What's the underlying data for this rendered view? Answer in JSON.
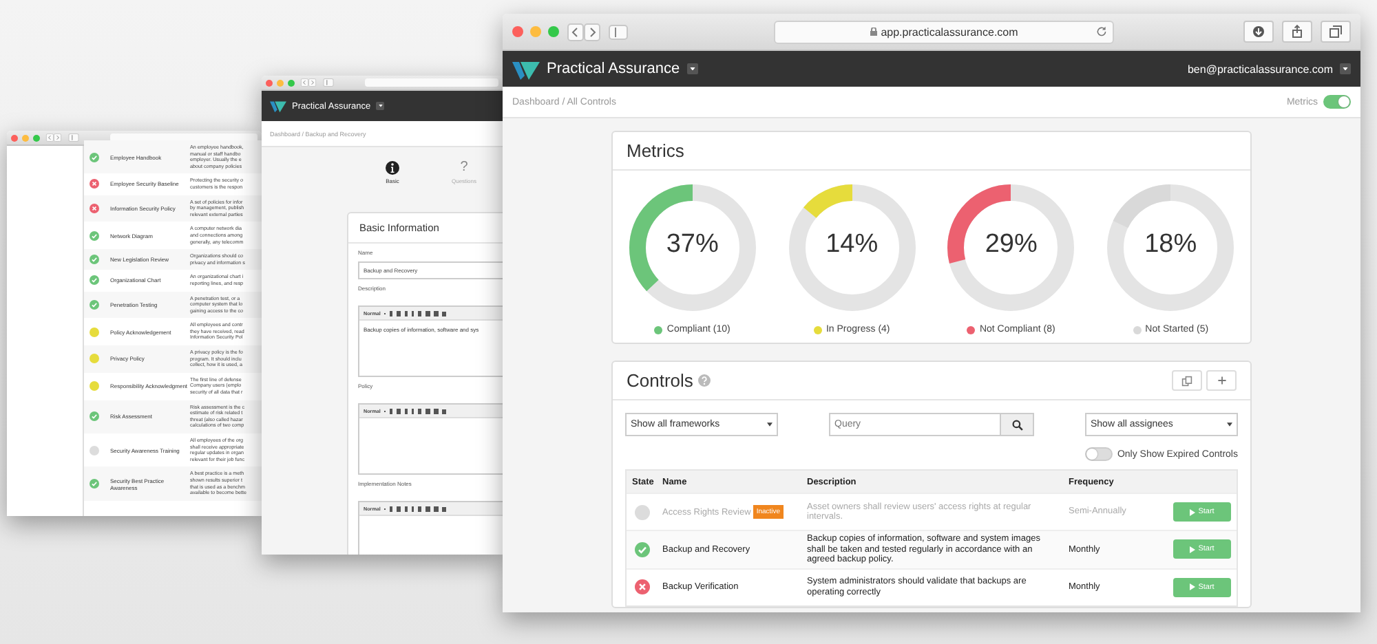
{
  "back_window": {
    "rows": [
      {
        "kind": "compliant",
        "name": "Employee Handbook",
        "lines": [
          "An employee handbook,",
          "manual or staff handbo",
          "employer. Usually the e",
          "about company policies"
        ]
      },
      {
        "kind": "not_compliant",
        "name": "Employee Security Baseline",
        "lines": [
          "Protecting the security o",
          "customers is the respon"
        ]
      },
      {
        "kind": "not_compliant",
        "name": "Information Security Policy",
        "lines": [
          "A set of policies for infor",
          "by management, publish",
          "relevant external parties"
        ]
      },
      {
        "kind": "compliant",
        "name": "Network Diagram",
        "lines": [
          "A computer network dia",
          "and connections among",
          "generally, any telecomm"
        ]
      },
      {
        "kind": "compliant",
        "name": "New Legislation Review",
        "lines": [
          "Organizations should co",
          "privacy and information s"
        ]
      },
      {
        "kind": "compliant",
        "name": "Organizational Chart",
        "lines": [
          "An organizational chart i",
          "reporting lines, and resp"
        ]
      },
      {
        "kind": "compliant",
        "name": "Penetration Testing",
        "lines": [
          "A penetration test, or a",
          "computer system that lo",
          "gaining access to the co"
        ]
      },
      {
        "kind": "in_progress",
        "name": "Policy Acknowledgement",
        "lines": [
          "All employees and contr",
          "they have received, read",
          "Information Security Pol"
        ]
      },
      {
        "kind": "in_progress",
        "name": "Privacy Policy",
        "lines": [
          "A privacy policy is the fo",
          "program. It should inclu",
          "collect, how it is used, a"
        ]
      },
      {
        "kind": "in_progress",
        "name": "Responsibility Acknowledgment",
        "lines": [
          "The first line of defense",
          "Company users (emplo",
          "security of all data that r"
        ]
      },
      {
        "kind": "compliant",
        "name": "Risk Assessment",
        "lines": [
          "Risk assessment is the c",
          "estimate of risk related t",
          "threat (also called hazar",
          "calculations of two comp"
        ]
      },
      {
        "kind": "not_started",
        "name": "Security Awareness Training",
        "lines": [
          "All employees of the org",
          "shall receive appropriate",
          "regular updates in organ",
          "relevant for their job func"
        ]
      },
      {
        "kind": "compliant",
        "name": "Security Best Practice Awareness",
        "lines": [
          "A best practice is a meth",
          "shown results superior t",
          "that is used as a benchm",
          "available to become bette"
        ]
      }
    ]
  },
  "middle_window": {
    "app_title": "Practical Assurance",
    "breadcrumb": "Dashboard / Backup and Recovery",
    "steps": [
      {
        "kind": "info",
        "label": "Basic",
        "selected": true
      },
      {
        "kind": "glyph",
        "glyph": "?",
        "label": "Questions",
        "selected": false
      }
    ],
    "card_title": "Basic Information",
    "fields": [
      {
        "kind": "text",
        "label": "Name",
        "value": "Backup and Recovery"
      },
      {
        "kind": "editor",
        "label": "Description",
        "style": "Normal",
        "value": "Backup copies of information, software and sys"
      },
      {
        "kind": "editor",
        "label": "Policy",
        "style": "Normal"
      },
      {
        "kind": "editor",
        "label": "Implementation Notes",
        "style": "Normal"
      }
    ]
  },
  "front_window": {
    "url": "app.practicalassurance.com",
    "app_title": "Practical Assurance",
    "user": "ben@practicalassurance.com",
    "breadcrumb": "Dashboard / All Controls",
    "metrics_toggle": {
      "label": "Metrics",
      "on": true
    },
    "metrics": {
      "title": "Metrics",
      "items": [
        {
          "percent": "37%",
          "level": 0.37,
          "label": "Compliant (10)",
          "color": "#6cc57a"
        },
        {
          "percent": "14%",
          "level": 0.14,
          "label": "In Progress (4)",
          "color": "#e6dc3c"
        },
        {
          "percent": "29%",
          "level": 0.29,
          "label": "Not Compliant (8)",
          "color": "#ec6170"
        },
        {
          "percent": "18%",
          "level": 0.18,
          "label": "Not Started (5)",
          "color": "#d9d9d9"
        }
      ]
    },
    "controls": {
      "title": "Controls",
      "framework_filter": "Show all frameworks",
      "query": {
        "placeholder": "Query"
      },
      "assignee_filter": "Show all assignees",
      "expired_toggle": {
        "label": "Only Show Expired Controls",
        "on": false
      },
      "columns": [
        "State",
        "Name",
        "Description",
        "Frequency"
      ],
      "rows": [
        {
          "kind": "not_started",
          "inactive": true,
          "name": "Access Rights Review",
          "badge": "Inactive",
          "description": "Asset owners shall review users' access rights at regular intervals.",
          "frequency": "Semi-Annually",
          "action": "Start"
        },
        {
          "kind": "compliant",
          "inactive": false,
          "name": "Backup and Recovery",
          "description": "Backup copies of information, software and system images shall be taken and tested regularly in accordance with an agreed backup policy.",
          "frequency": "Monthly",
          "action": "Start"
        },
        {
          "kind": "not_compliant",
          "inactive": false,
          "name": "Backup Verification",
          "description": "System administrators should validate that backups are operating correctly",
          "frequency": "Monthly",
          "action": "Start"
        }
      ]
    }
  }
}
